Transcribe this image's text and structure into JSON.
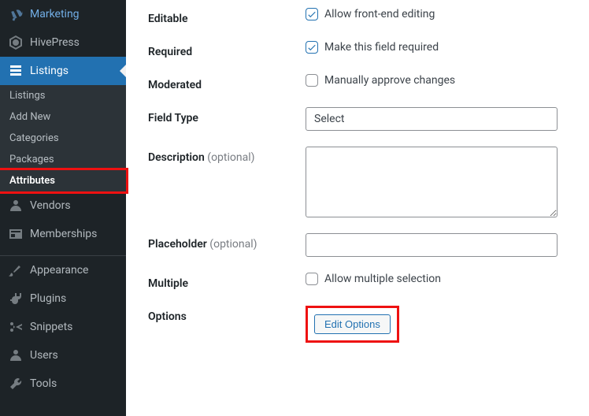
{
  "sidebar": {
    "top": [
      {
        "name": "marketing",
        "label": "Marketing",
        "icon": "megaphone"
      },
      {
        "name": "hivepress",
        "label": "HivePress",
        "icon": "hive"
      },
      {
        "name": "listings",
        "label": "Listings",
        "icon": "listings",
        "active": true,
        "submenu": [
          {
            "name": "listings-all",
            "label": "Listings"
          },
          {
            "name": "add-new",
            "label": "Add New"
          },
          {
            "name": "categories",
            "label": "Categories"
          },
          {
            "name": "packages",
            "label": "Packages"
          },
          {
            "name": "attributes",
            "label": "Attributes",
            "current": true,
            "highlighted": true
          }
        ]
      },
      {
        "name": "vendors",
        "label": "Vendors",
        "icon": "user"
      },
      {
        "name": "memberships",
        "label": "Memberships",
        "icon": "card"
      }
    ],
    "bottom": [
      {
        "name": "appearance",
        "label": "Appearance",
        "icon": "brush"
      },
      {
        "name": "plugins",
        "label": "Plugins",
        "icon": "plug"
      },
      {
        "name": "snippets",
        "label": "Snippets",
        "icon": "scissors"
      },
      {
        "name": "users",
        "label": "Users",
        "icon": "users"
      },
      {
        "name": "tools",
        "label": "Tools",
        "icon": "wrench"
      }
    ]
  },
  "form": {
    "editable": {
      "label": "Editable",
      "checkbox_label": "Allow front-end editing",
      "checked": true
    },
    "required": {
      "label": "Required",
      "checkbox_label": "Make this field required",
      "checked": true
    },
    "moderated": {
      "label": "Moderated",
      "checkbox_label": "Manually approve changes",
      "checked": false
    },
    "field_type": {
      "label": "Field Type",
      "value": "Select"
    },
    "description": {
      "label": "Description",
      "optional": "(optional)",
      "value": ""
    },
    "placeholder": {
      "label": "Placeholder",
      "optional": "(optional)",
      "value": ""
    },
    "multiple": {
      "label": "Multiple",
      "checkbox_label": "Allow multiple selection",
      "checked": false
    },
    "options": {
      "label": "Options",
      "button": "Edit Options"
    }
  }
}
